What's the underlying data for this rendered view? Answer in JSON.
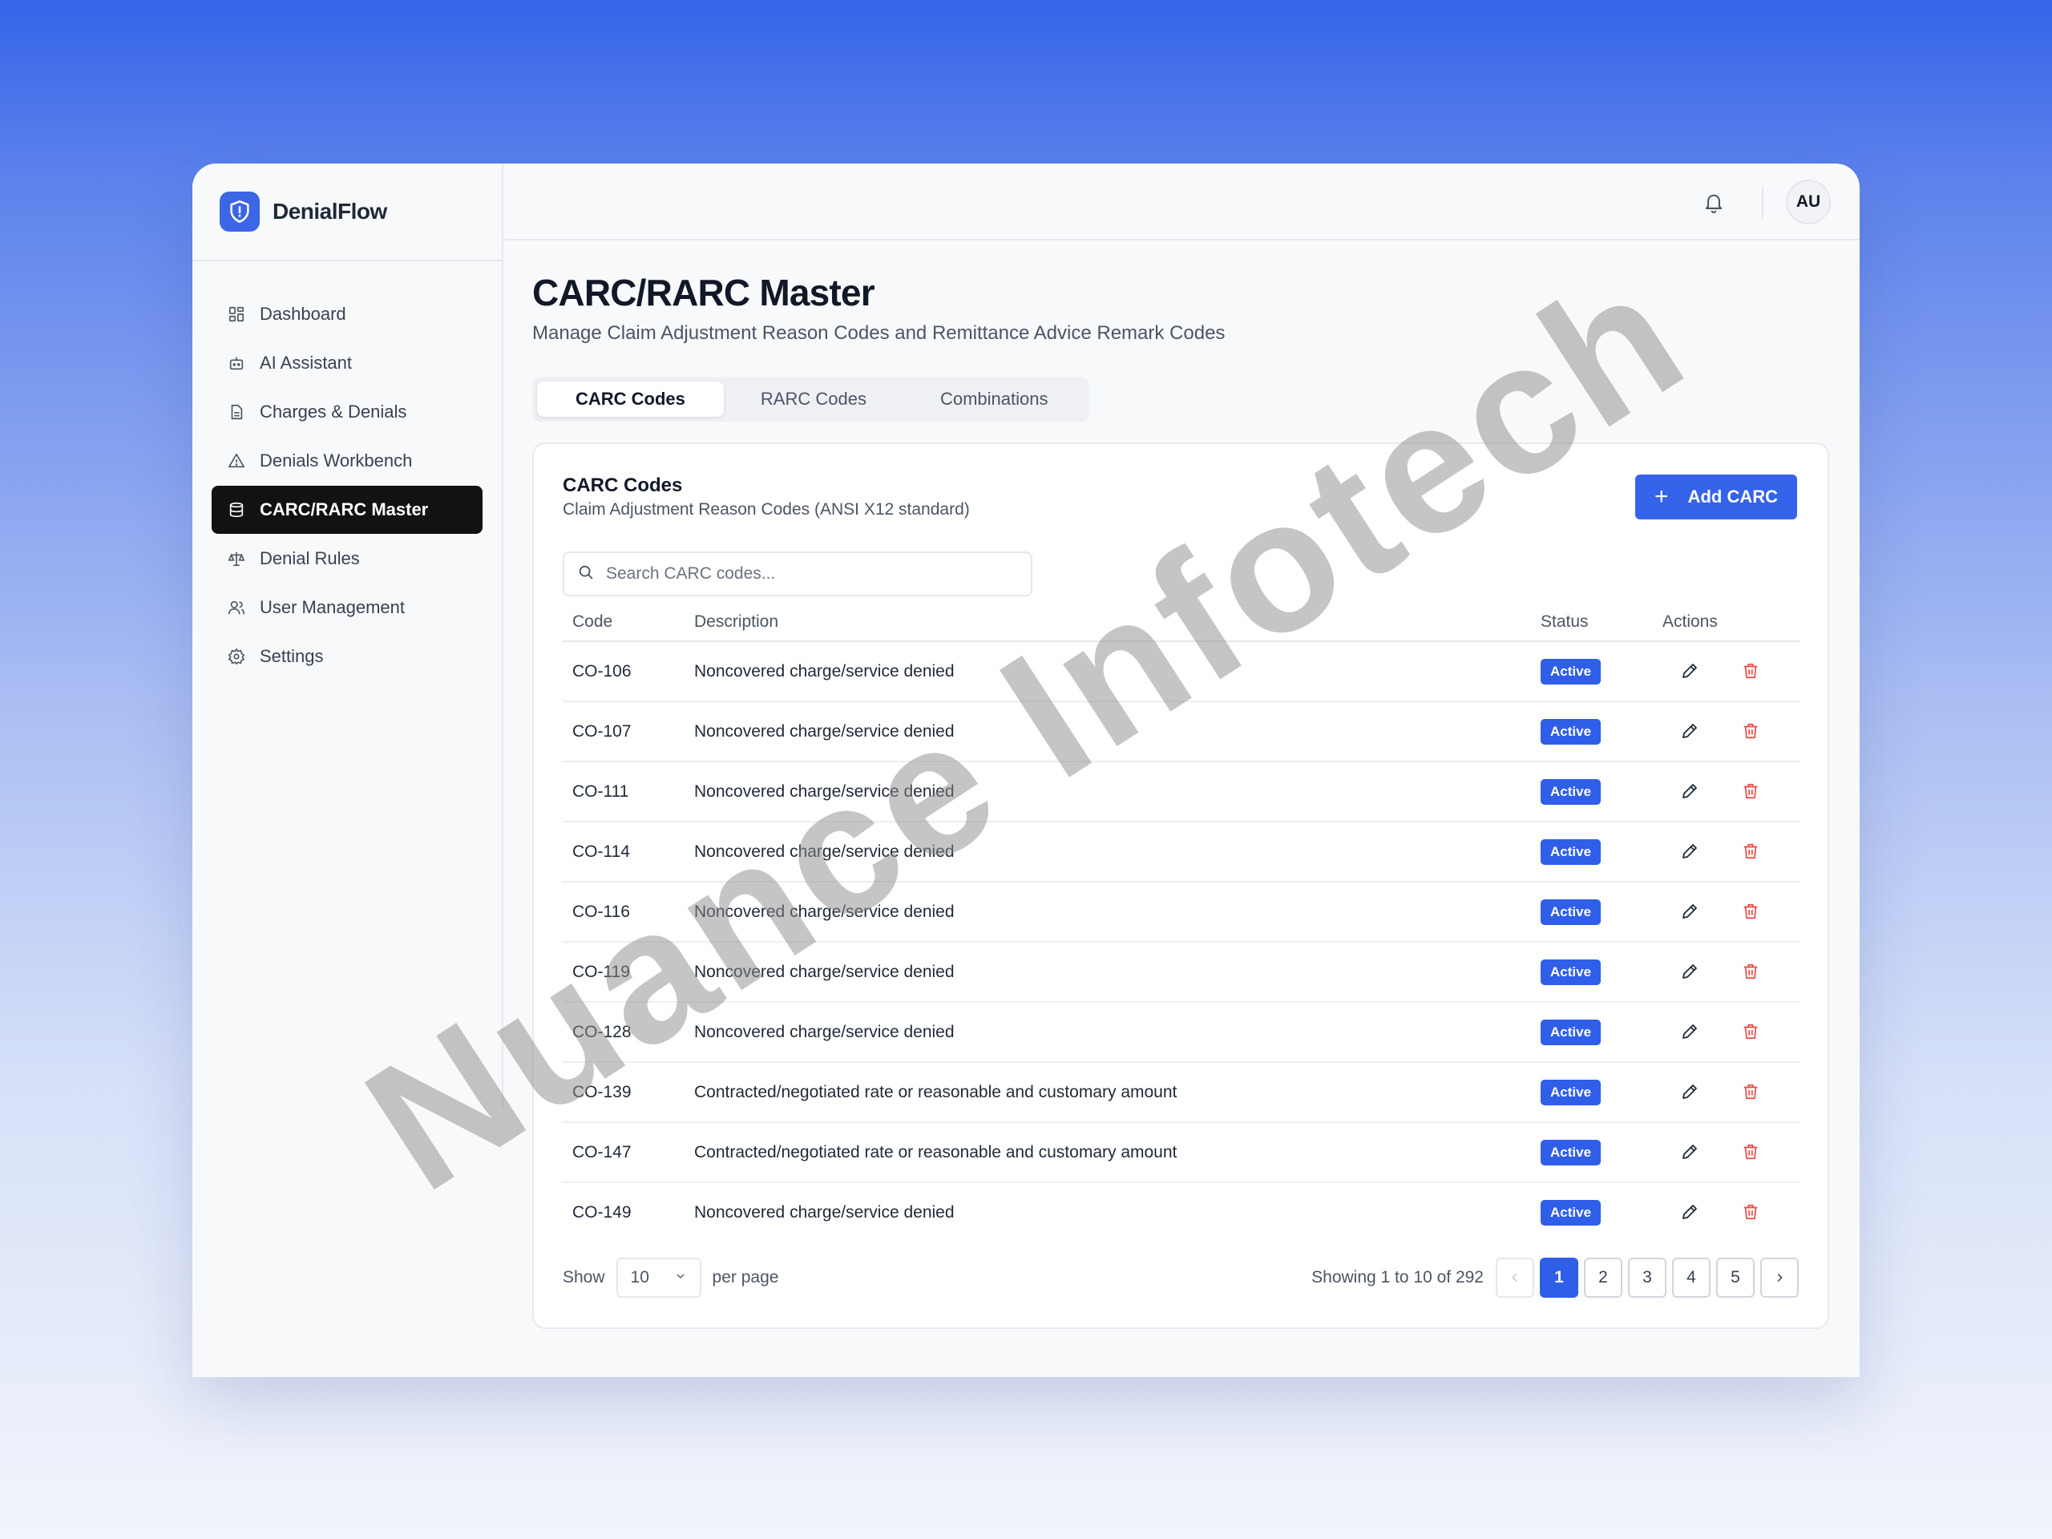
{
  "app": {
    "name": "DenialFlow"
  },
  "sidebar": {
    "items": [
      {
        "label": "Dashboard",
        "icon": "grid-icon"
      },
      {
        "label": "AI Assistant",
        "icon": "bot-icon"
      },
      {
        "label": "Charges & Denials",
        "icon": "document-icon"
      },
      {
        "label": "Denials Workbench",
        "icon": "warning-icon"
      },
      {
        "label": "CARC/RARC Master",
        "icon": "database-icon",
        "active": true
      },
      {
        "label": "Denial Rules",
        "icon": "scale-icon"
      },
      {
        "label": "User Management",
        "icon": "users-icon"
      },
      {
        "label": "Settings",
        "icon": "gear-icon"
      }
    ]
  },
  "header": {
    "avatar_initials": "AU"
  },
  "page": {
    "title": "CARC/RARC Master",
    "subtitle": "Manage Claim Adjustment Reason Codes and Remittance Advice Remark Codes"
  },
  "tabs": [
    {
      "label": "CARC Codes",
      "active": true
    },
    {
      "label": "RARC Codes"
    },
    {
      "label": "Combinations"
    }
  ],
  "card": {
    "title": "CARC Codes",
    "subtitle": "Claim Adjustment Reason Codes (ANSI X12 standard)",
    "add_label": "Add CARC",
    "search_placeholder": "Search CARC codes..."
  },
  "table": {
    "columns": [
      "Code",
      "Description",
      "Status",
      "Actions"
    ],
    "rows": [
      {
        "code": "CO-106",
        "description": "Noncovered charge/service denied",
        "status": "Active"
      },
      {
        "code": "CO-107",
        "description": "Noncovered charge/service denied",
        "status": "Active"
      },
      {
        "code": "CO-111",
        "description": "Noncovered charge/service denied",
        "status": "Active"
      },
      {
        "code": "CO-114",
        "description": "Noncovered charge/service denied",
        "status": "Active"
      },
      {
        "code": "CO-116",
        "description": "Noncovered charge/service denied",
        "status": "Active"
      },
      {
        "code": "CO-119",
        "description": "Noncovered charge/service denied",
        "status": "Active"
      },
      {
        "code": "CO-128",
        "description": "Noncovered charge/service denied",
        "status": "Active"
      },
      {
        "code": "CO-139",
        "description": "Contracted/negotiated rate or reasonable and customary amount",
        "status": "Active"
      },
      {
        "code": "CO-147",
        "description": "Contracted/negotiated rate or reasonable and customary amount",
        "status": "Active"
      },
      {
        "code": "CO-149",
        "description": "Noncovered charge/service denied",
        "status": "Active"
      }
    ]
  },
  "pagination": {
    "show_label": "Show",
    "per_page_value": "10",
    "per_page_label": "per page",
    "showing_text": "Showing 1 to 10 of 292",
    "pages": [
      "1",
      "2",
      "3",
      "4",
      "5"
    ],
    "current_page": "1"
  },
  "watermark": "Nuance Infotech",
  "colors": {
    "accent": "#2f5ee8",
    "danger": "#ef4444",
    "sidebar_active": "#111214"
  }
}
